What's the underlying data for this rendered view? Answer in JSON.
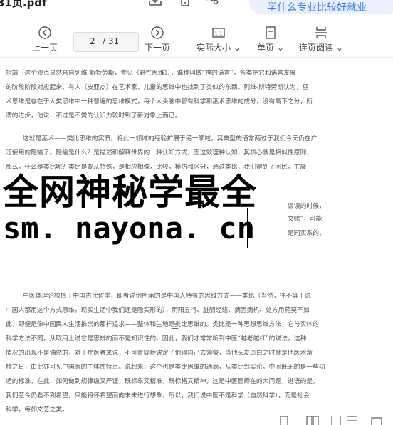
{
  "header": {
    "file_title": "31页.pdf",
    "download_icon": "download-icon",
    "phone_icon": "phone-icon",
    "share_icon": "share-icon",
    "promo_text": "学什么专业比较好就业"
  },
  "toolbar": {
    "prev_label": "上一页",
    "next_label": "下一页",
    "current_page": "2",
    "total_pages": "/ 31",
    "actual_size_label": "实际大小",
    "single_page_label": "单页",
    "continuous_label": "连页阅读"
  },
  "document": {
    "para1": [
      "指端（这个观点显然来自列维-斯特劳斯，参见《野性思维》），谁称叫做“神的语言”，各类把它和语言发展",
      "的阶段阶段对应起来，有人（皮亚杰）在艺术家、儿童的思维中也找到了类似的东西。列维-斯特劳斯认为，巫",
      "术思维是存在于人类思维中一种普遍的思维模式，每个人头脑中都有科学和巫术思维的成分，没有高下之分，所",
      "谓的进步，他说，不过是不觉的认识力较时到了新对象上而已。"
    ],
    "para2": [
      "这就是巫术——类比思维的实质，将此一领域的经验扩展于另一领域，其典型的通常两过于我们今天仍在广",
      "泛使用的隐喻了。隐喻是什么？是描述和解释世界的一种认知方式，因这效理种认知，其核心就是相似性原则，",
      "那么，什么是类比呢？类比是要从特殊，是相应相像，比较，模仿和区分，通过类比，我们得到了回民，扩展"
    ],
    "side1": "谬误的时候，",
    "side2": "文赐”，可能",
    "side3": "是同实系的，",
    "section_number": "二",
    "para3": [
      "中医体理论根植于中国古代哲学，即者说他所承的是中国人特有的思维方式——类比（当然，往不等于说",
      "中国人都用这个方式思维，现实生活中我们还是隐实形的），阴阳五行、脏腑经络、病因病机、处方用药莫不如",
      "此，即便是像中国民人生活推崇的那样追求——整体和生地是类比思维的。类比是一种思想思维方法，它与实体的",
      "科学方法不同，从取用上说它是思辨的而不是知识性的。因此，我们才常常听到中医“越老越红”的说法，这种",
      "情况的出现不是偶然的，对于疗医者来说，不可置疑症诀定了他得自己去领察，当他头发斑白之时就是他医术渐",
      "精之日，由此亦可见中国医的主体性特点。说起来，这个也是类比思维的通病，从类比到实论，中间既无的是一些功",
      "适的标准，在此，如何做到规律级又严谨，既标象又精准，既标格又精神，这是中医医师在的大问题，进语的是，",
      "我们至今仍看不到希望，只能将怀希望而向未来进行想象，所以，我们说中医不是科学（自然科学），而是社会",
      "科学，每如文艺之类。"
    ]
  },
  "overlay": {
    "line1": "全网神秘学最全",
    "line2": "sm. nayona. cn"
  },
  "bottombar": {
    "icons": [
      "page-view-icon",
      "two-page-icon",
      "fit-icon",
      "fullscreen-icon",
      "more-icon"
    ]
  }
}
